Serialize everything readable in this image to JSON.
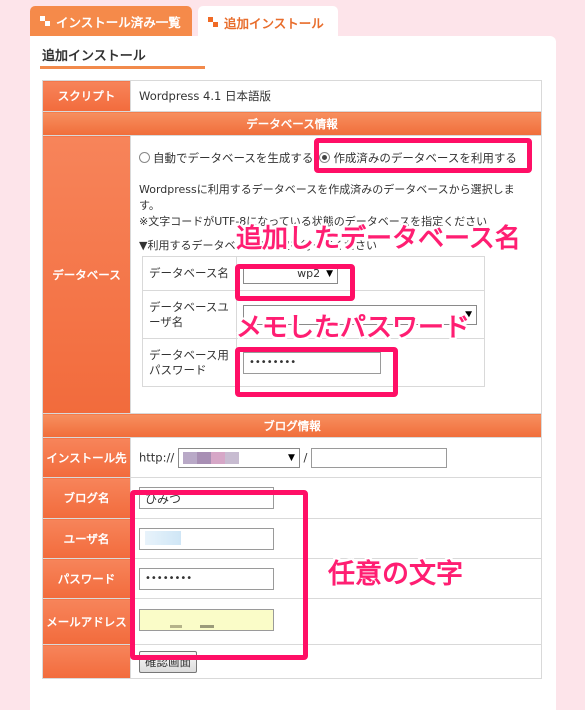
{
  "tabs": [
    {
      "label": "インストール済み一覧",
      "active": false
    },
    {
      "label": "追加インストール",
      "active": true
    }
  ],
  "section_title": "追加インストール",
  "script": {
    "label": "スクリプト",
    "value": "Wordpress 4.1 日本語版"
  },
  "db_section_header": "データベース情報",
  "database": {
    "label": "データベース",
    "radio_auto": "自動でデータベースを生成する",
    "radio_existing": "作成済みのデータベースを利用する",
    "note1": "Wordpressに利用するデータベースを作成済みのデータベースから選択します。",
    "note2": "※文字コードがUTF-8になっている状態のデータベースを指定ください",
    "note3": "▼利用するデータベースの指定を行ってください",
    "db_name_label": "データベース名",
    "db_name_value": "wp2",
    "db_user_label": "データベースユーザ名",
    "db_pass_label": "データベース用パスワード",
    "db_pass_value": "••••••••"
  },
  "blog_section_header": "ブログ情報",
  "blog": {
    "install_label": "インストール先",
    "install_prefix": "http://",
    "install_sep": "/",
    "blog_name_label": "ブログ名",
    "blog_name_value": "ひみつ",
    "user_label": "ユーザ名",
    "password_label": "パスワード",
    "password_value": "••••••••",
    "email_label": "メールアドレス"
  },
  "confirm_button": "確認画面",
  "annotations": {
    "db_name_note": "追加したデータベース名",
    "password_note": "メモしたパスワード",
    "free_text_note": "任意の文字"
  },
  "colors": {
    "accent": "#f26b3c",
    "highlight": "#ff0f66",
    "background": "#fde4ea"
  }
}
